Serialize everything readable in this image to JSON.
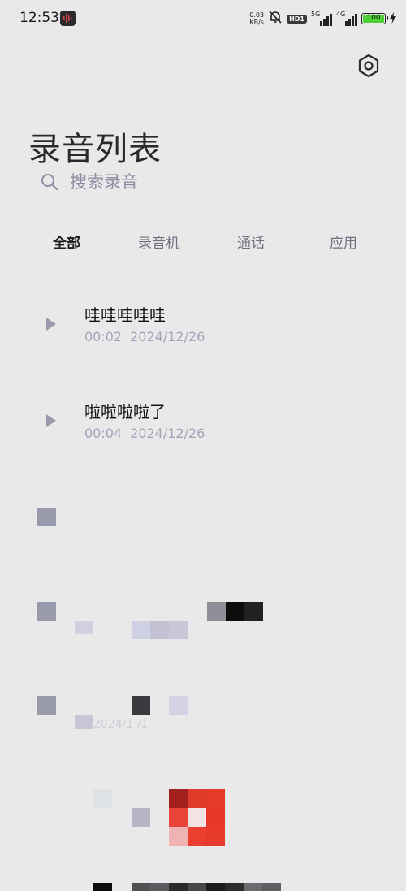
{
  "status_bar": {
    "time": "12:53",
    "net_speed_value": "0.03",
    "net_speed_unit": "KB/s",
    "hd_badge": "HD1",
    "signal1_label": "5G",
    "signal2_label": "4G",
    "battery_level": "100",
    "battery_fraction": 1.0,
    "battery_color": "#4cd137"
  },
  "header": {
    "title": "录音列表",
    "settings_icon": "settings-hexagon-icon"
  },
  "search": {
    "placeholder": "搜索录音",
    "value": ""
  },
  "tabs": [
    {
      "label": "全部",
      "active": true
    },
    {
      "label": "录音机",
      "active": false
    },
    {
      "label": "通话",
      "active": false
    },
    {
      "label": "应用",
      "active": false
    }
  ],
  "recordings": [
    {
      "name": "哇哇哇哇哇",
      "duration": "00:02",
      "date": "2024/12/26"
    },
    {
      "name": "啦啦啦啦了",
      "duration": "00:04",
      "date": "2024/12/26"
    }
  ],
  "pixelated_date": "2024/1 /1",
  "colors": {
    "background": "#e9e9ea",
    "accent_muted": "#9a9aad",
    "secondary_text": "#a4a4b8"
  }
}
